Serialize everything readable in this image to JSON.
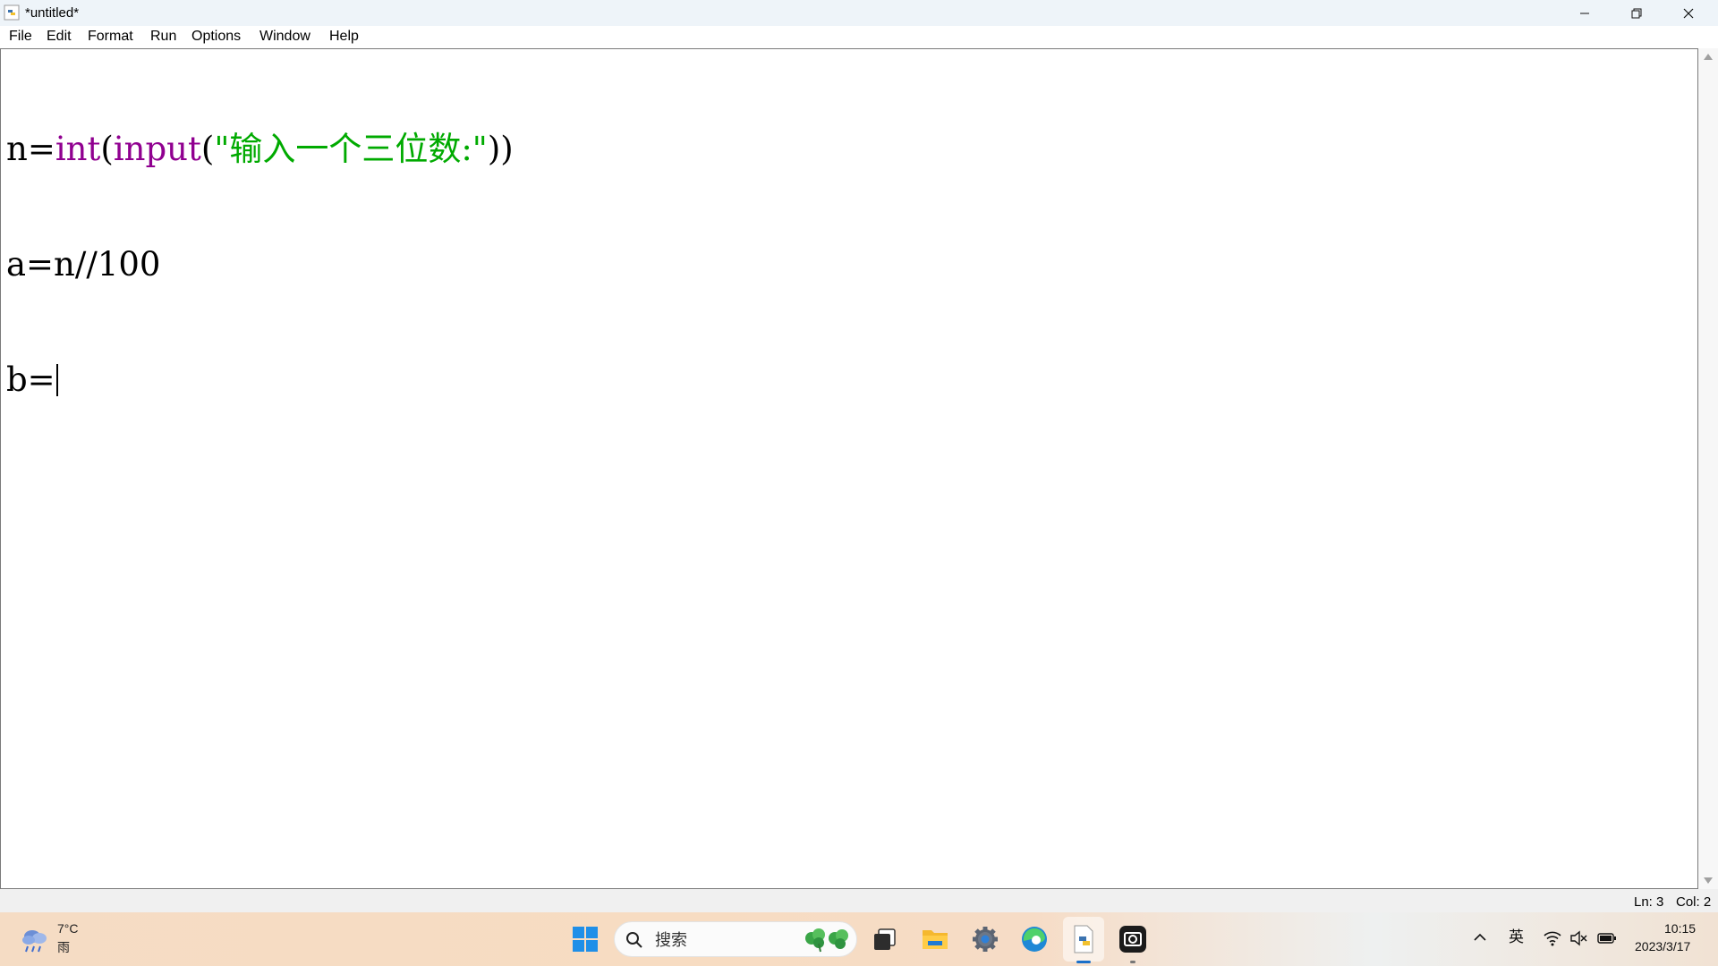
{
  "window": {
    "title": "*untitled*",
    "minimize_icon": "minimize-icon",
    "restore_icon": "restore-icon",
    "close_icon": "close-icon"
  },
  "menu": {
    "items": [
      "File",
      "Edit",
      "Format",
      "Run",
      "Options",
      "Window",
      "Help"
    ]
  },
  "editor": {
    "line1": {
      "p1": "n=",
      "p2": "int",
      "p3": "(",
      "p4": "input",
      "p5": "(",
      "p6": "\"输入一个三位数:\"",
      "p7": "))"
    },
    "line2": "a=n//100",
    "line3": "b="
  },
  "status": {
    "line": "Ln: 3",
    "col": "Col: 2"
  },
  "taskbar": {
    "weather": {
      "temp": "7°C",
      "condition": "雨"
    },
    "search_placeholder": "搜索",
    "tray": {
      "ime": "英"
    },
    "clock": {
      "time": "10:15",
      "date": "2023/3/17"
    }
  },
  "colors": {
    "keyword": "#900090",
    "string": "#00aa00",
    "accent": "#1a6fc9"
  }
}
